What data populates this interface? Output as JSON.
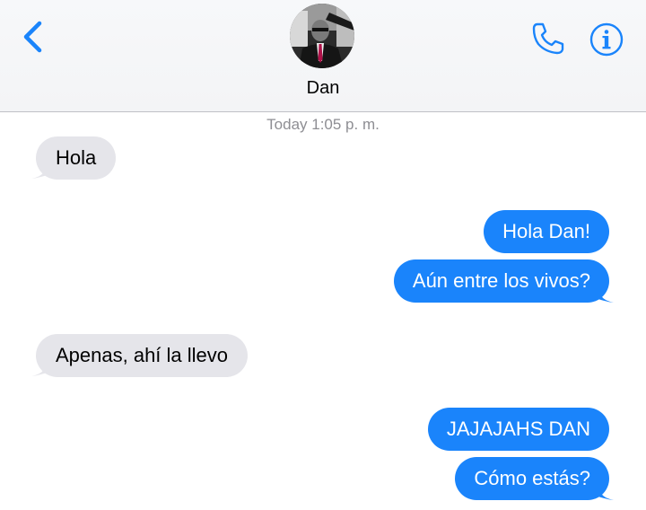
{
  "header": {
    "contact_name": "Dan",
    "back_icon": "chevron-left-icon",
    "call_icon": "phone-icon",
    "info_icon": "info-icon",
    "accent_color": "#1a84fb"
  },
  "conversation": {
    "timestamp": "Today 1:05 p. m.",
    "messages": [
      {
        "direction": "incoming",
        "text": "Hola"
      },
      {
        "direction": "outgoing",
        "text": "Hola Dan!"
      },
      {
        "direction": "outgoing",
        "text": "Aún entre los vivos?"
      },
      {
        "direction": "incoming",
        "text": "Apenas, ahí la llevo"
      },
      {
        "direction": "outgoing",
        "text": "JAJAJAHS DAN"
      },
      {
        "direction": "outgoing",
        "text": "Cómo estás?"
      }
    ]
  },
  "colors": {
    "incoming_bubble": "#e5e5ea",
    "outgoing_bubble": "#1a84fb"
  }
}
